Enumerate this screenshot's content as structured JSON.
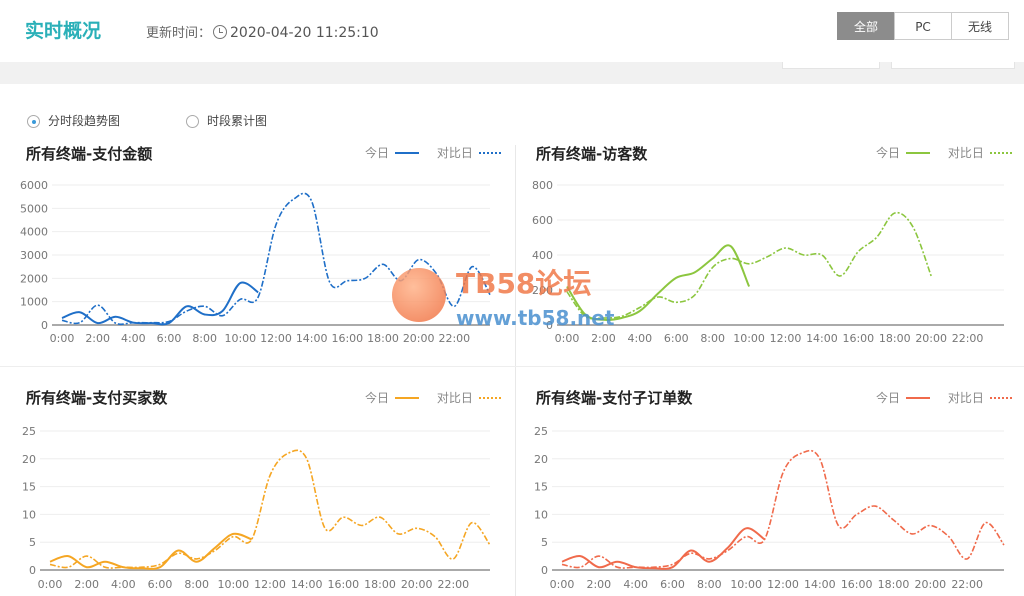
{
  "header": {
    "title": "实时概况",
    "update_label": "更新时间：",
    "update_time": "2020-04-20 11:25:10",
    "tabs": [
      {
        "label": "全部",
        "active": true
      },
      {
        "label": "PC",
        "active": false
      },
      {
        "label": "无线",
        "active": false
      }
    ]
  },
  "view_options": [
    {
      "label": "分时段趋势图",
      "checked": true
    },
    {
      "label": "时段累计图",
      "checked": false
    }
  ],
  "watermark": {
    "brand": "TB58论坛",
    "url": "www.tb58.net"
  },
  "chart_data": [
    {
      "type": "line",
      "title": "所有终端-支付金额",
      "color": "#1f6fc8",
      "ylim": [
        0,
        6000
      ],
      "yticks": [
        0,
        1000,
        2000,
        3000,
        4000,
        5000,
        6000
      ],
      "x_ticks": [
        "0:00",
        "2:00",
        "4:00",
        "6:00",
        "8:00",
        "10:00",
        "12:00",
        "14:00",
        "16:00",
        "18:00",
        "20:00",
        "22:00"
      ],
      "legend": {
        "today": "今日",
        "compare": "对比日"
      },
      "series": [
        {
          "name": "今日",
          "style": "solid",
          "values": [
            300,
            550,
            80,
            350,
            100,
            80,
            80,
            800,
            450,
            600,
            1800,
            1400
          ]
        },
        {
          "name": "对比日",
          "style": "dashed",
          "values": [
            200,
            100,
            850,
            80,
            100,
            100,
            150,
            600,
            800,
            400,
            1100,
            1200,
            4300,
            5400,
            5300,
            1850,
            1900,
            2000,
            2600,
            1900,
            2800,
            2200,
            800,
            2500,
            1300
          ]
        }
      ]
    },
    {
      "type": "line",
      "title": "所有终端-访客数",
      "color": "#8cc63f",
      "ylim": [
        0,
        800
      ],
      "yticks": [
        0,
        200,
        400,
        600,
        800
      ],
      "x_ticks": [
        "0:00",
        "2:00",
        "4:00",
        "6:00",
        "8:00",
        "10:00",
        "12:00",
        "14:00",
        "16:00",
        "18:00",
        "20:00",
        "22:00"
      ],
      "legend": {
        "today": "今日",
        "compare": "对比日"
      },
      "series": [
        {
          "name": "今日",
          "style": "solid",
          "values": [
            220,
            60,
            30,
            40,
            80,
            180,
            270,
            300,
            380,
            450,
            220
          ]
        },
        {
          "name": "对比日",
          "style": "dashed",
          "values": [
            190,
            50,
            40,
            50,
            100,
            160,
            130,
            170,
            330,
            380,
            350,
            390,
            440,
            400,
            400,
            280,
            420,
            500,
            640,
            560,
            280
          ]
        }
      ]
    },
    {
      "type": "line",
      "title": "所有终端-支付买家数",
      "color": "#f5a623",
      "ylim": [
        0,
        25
      ],
      "yticks": [
        0,
        5,
        10,
        15,
        20,
        25
      ],
      "x_ticks": [
        "0:00",
        "2:00",
        "4:00",
        "6:00",
        "8:00",
        "10:00",
        "12:00",
        "14:00",
        "16:00",
        "18:00",
        "20:00",
        "22:00"
      ],
      "legend": {
        "today": "今日",
        "compare": "对比日"
      },
      "series": [
        {
          "name": "今日",
          "style": "solid",
          "values": [
            1.5,
            2.5,
            0.5,
            1.5,
            0.5,
            0.3,
            0.5,
            3.5,
            1.5,
            4,
            6.5,
            5.5
          ]
        },
        {
          "name": "对比日",
          "style": "dashed",
          "values": [
            1,
            0.5,
            2.5,
            0.5,
            0.5,
            0.5,
            1,
            3,
            2,
            3.5,
            6,
            5.5,
            17,
            21,
            20,
            7.5,
            9.5,
            8,
            9.5,
            6.5,
            7.5,
            6,
            2,
            8.5,
            4.5
          ]
        }
      ]
    },
    {
      "type": "line",
      "title": "所有终端-支付子订单数",
      "color": "#f06a4b",
      "ylim": [
        0,
        25
      ],
      "yticks": [
        0,
        5,
        10,
        15,
        20,
        25
      ],
      "x_ticks": [
        "0:00",
        "2:00",
        "4:00",
        "6:00",
        "8:00",
        "10:00",
        "12:00",
        "14:00",
        "16:00",
        "18:00",
        "20:00",
        "22:00"
      ],
      "legend": {
        "today": "今日",
        "compare": "对比日"
      },
      "series": [
        {
          "name": "今日",
          "style": "solid",
          "values": [
            1.5,
            2.5,
            0.5,
            1.5,
            0.5,
            0.3,
            0.5,
            3.5,
            1.5,
            4,
            7.5,
            5.5
          ]
        },
        {
          "name": "对比日",
          "style": "dashed",
          "values": [
            1,
            0.5,
            2.5,
            0.5,
            0.5,
            0.5,
            1,
            3,
            2,
            3.5,
            6,
            5.5,
            17.5,
            21,
            20,
            8,
            10,
            11.5,
            9,
            6.5,
            8,
            6,
            2,
            8.5,
            4.5
          ]
        }
      ]
    }
  ]
}
